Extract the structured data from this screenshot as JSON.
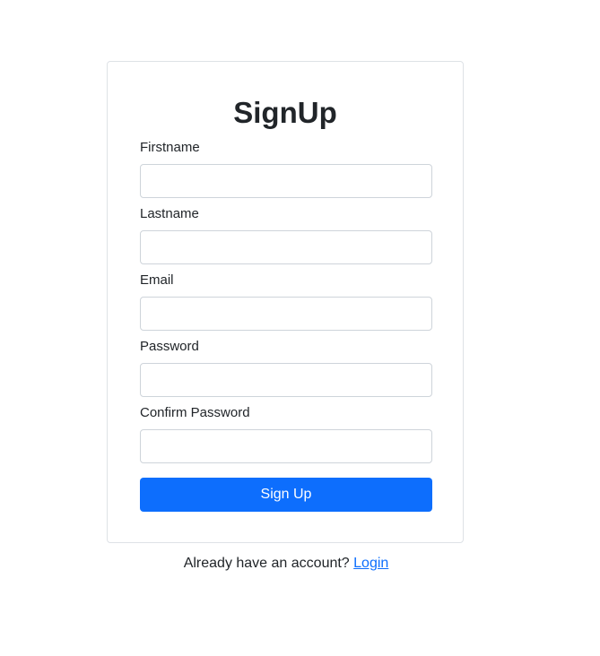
{
  "form": {
    "title": "SignUp",
    "fields": [
      {
        "label": "Firstname",
        "value": "",
        "placeholder": ""
      },
      {
        "label": "Lastname",
        "value": "",
        "placeholder": ""
      },
      {
        "label": "Email",
        "value": "",
        "placeholder": ""
      },
      {
        "label": "Password",
        "value": "",
        "placeholder": ""
      },
      {
        "label": "Confirm Password",
        "value": "",
        "placeholder": ""
      }
    ],
    "submit_label": "Sign Up"
  },
  "footer": {
    "text": "Already have an account?",
    "link_label": "Login"
  },
  "colors": {
    "primary": "#0d6efd",
    "text": "#212529",
    "border": "#dee2e6",
    "input_border": "#ced4da"
  }
}
